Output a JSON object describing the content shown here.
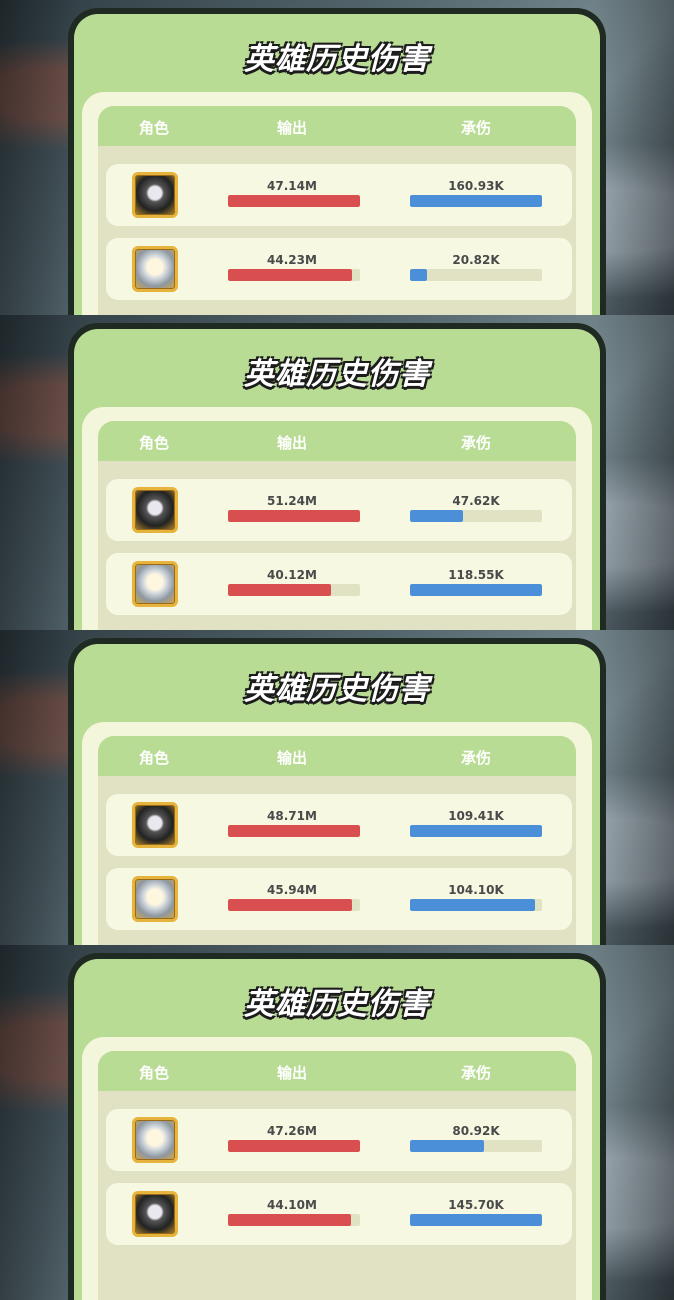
{
  "screens": [
    {
      "title": "英雄历史伤害",
      "headers": {
        "role": "角色",
        "output": "输出",
        "taken": "承伤"
      },
      "rows": [
        {
          "avatar": "dark-hero-icon",
          "output_label": "47.14M",
          "output_fill": 1.0,
          "taken_label": "160.93K",
          "taken_fill": 1.0
        },
        {
          "avatar": "light-hero-icon",
          "output_label": "44.23M",
          "output_fill": 0.94,
          "taken_label": "20.82K",
          "taken_fill": 0.13
        }
      ]
    },
    {
      "title": "英雄历史伤害",
      "headers": {
        "role": "角色",
        "output": "输出",
        "taken": "承伤"
      },
      "rows": [
        {
          "avatar": "dark-hero-icon",
          "output_label": "51.24M",
          "output_fill": 1.0,
          "taken_label": "47.62K",
          "taken_fill": 0.4
        },
        {
          "avatar": "light-hero-icon",
          "output_label": "40.12M",
          "output_fill": 0.78,
          "taken_label": "118.55K",
          "taken_fill": 1.0
        }
      ]
    },
    {
      "title": "英雄历史伤害",
      "headers": {
        "role": "角色",
        "output": "输出",
        "taken": "承伤"
      },
      "rows": [
        {
          "avatar": "dark-hero-icon",
          "output_label": "48.71M",
          "output_fill": 1.0,
          "taken_label": "109.41K",
          "taken_fill": 1.0
        },
        {
          "avatar": "light-hero-icon",
          "output_label": "45.94M",
          "output_fill": 0.94,
          "taken_label": "104.10K",
          "taken_fill": 0.95
        }
      ]
    },
    {
      "title": "英雄历史伤害",
      "headers": {
        "role": "角色",
        "output": "输出",
        "taken": "承伤"
      },
      "rows": [
        {
          "avatar": "light-hero-icon",
          "output_label": "47.26M",
          "output_fill": 1.0,
          "taken_label": "80.92K",
          "taken_fill": 0.56
        },
        {
          "avatar": "dark-hero-icon",
          "output_label": "44.10M",
          "output_fill": 0.93,
          "taken_label": "145.70K",
          "taken_fill": 1.0
        }
      ]
    }
  ],
  "colors": {
    "panel": "#b9dc95",
    "output_bar": "#d94f4f",
    "taken_bar": "#4c8fd9"
  }
}
